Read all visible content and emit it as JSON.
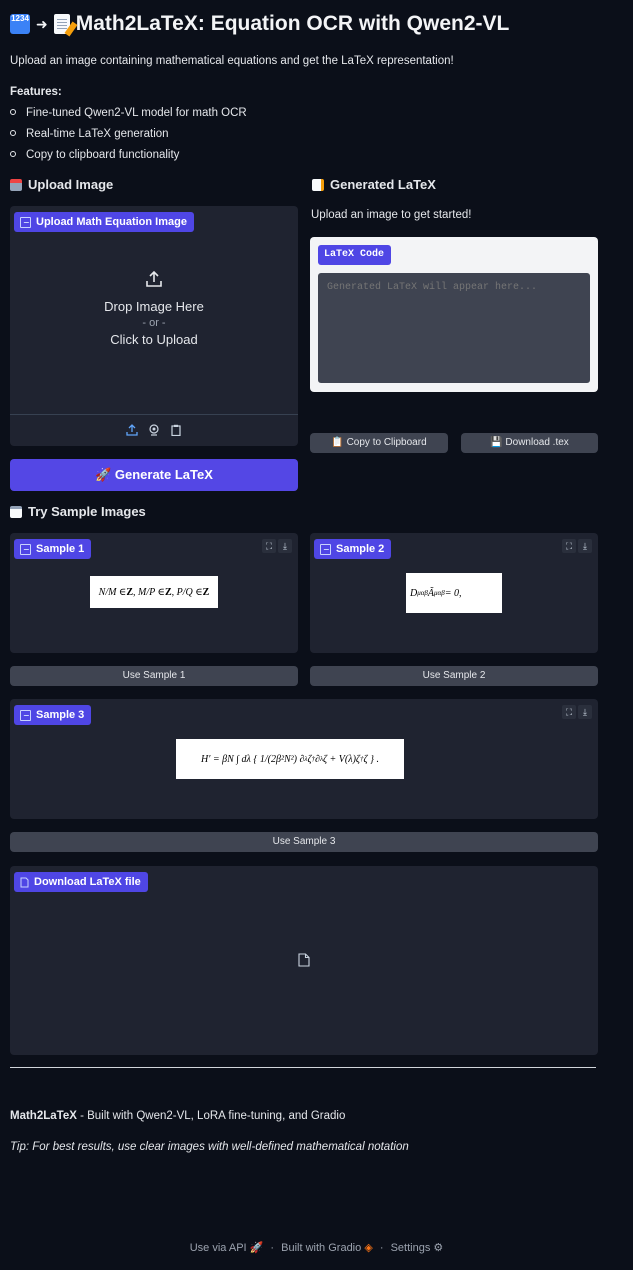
{
  "header": {
    "title": "Math2LaTeX: Equation OCR with Qwen2-VL",
    "emoji_numbers": "1234",
    "arrow": "➜",
    "subtitle": "Upload an image containing mathematical equations and get the LaTeX representation!"
  },
  "features": {
    "heading": "Features:",
    "items": [
      "Fine-tuned Qwen2-VL model for math OCR",
      "Real-time LaTeX generation",
      "Copy to clipboard functionality"
    ]
  },
  "upload": {
    "heading": "Upload Image",
    "chip_label": "Upload Math Equation Image",
    "drop_text": "Drop Image Here",
    "or_text": "- or -",
    "click_text": "Click to Upload",
    "generate_button": "🚀 Generate LaTeX"
  },
  "output": {
    "heading": "Generated LaTeX",
    "status": "Upload an image to get started!",
    "code_label": "LaTeX Code",
    "code_placeholder": "Generated LaTeX will appear here...",
    "copy_button": "📋 Copy to Clipboard",
    "download_button": "💾 Download .tex"
  },
  "samples": {
    "heading": "Try Sample Images",
    "items": [
      {
        "label": "Sample 1",
        "button": "Use Sample 1"
      },
      {
        "label": "Sample 2",
        "button": "Use Sample 2"
      },
      {
        "label": "Sample 3",
        "button": "Use Sample 3"
      }
    ]
  },
  "download_file": {
    "label": "Download LaTeX file"
  },
  "footer": {
    "brand": "Math2LaTeX",
    "credit": " - Built with Qwen2-VL, LoRA fine-tuning, and Gradio",
    "tip": "Tip: For best results, use clear images with well-defined mathematical notation",
    "links": [
      "Use via API",
      "Built with Gradio",
      "Settings"
    ],
    "separator": "·"
  },
  "colors": {
    "background": "#0b0f19",
    "panel": "#1f2330",
    "accent": "#5447e5",
    "button_gray": "#3f4451"
  },
  "icons": {
    "title_prefix": [
      "input-numbers-icon",
      "arrow-icon",
      "memo-icon"
    ],
    "upload_toolbar": [
      "upload-icon",
      "webcam-icon",
      "clipboard-icon"
    ],
    "sample_corner": [
      "fullscreen-icon",
      "download-icon"
    ],
    "file": "file-icon"
  }
}
